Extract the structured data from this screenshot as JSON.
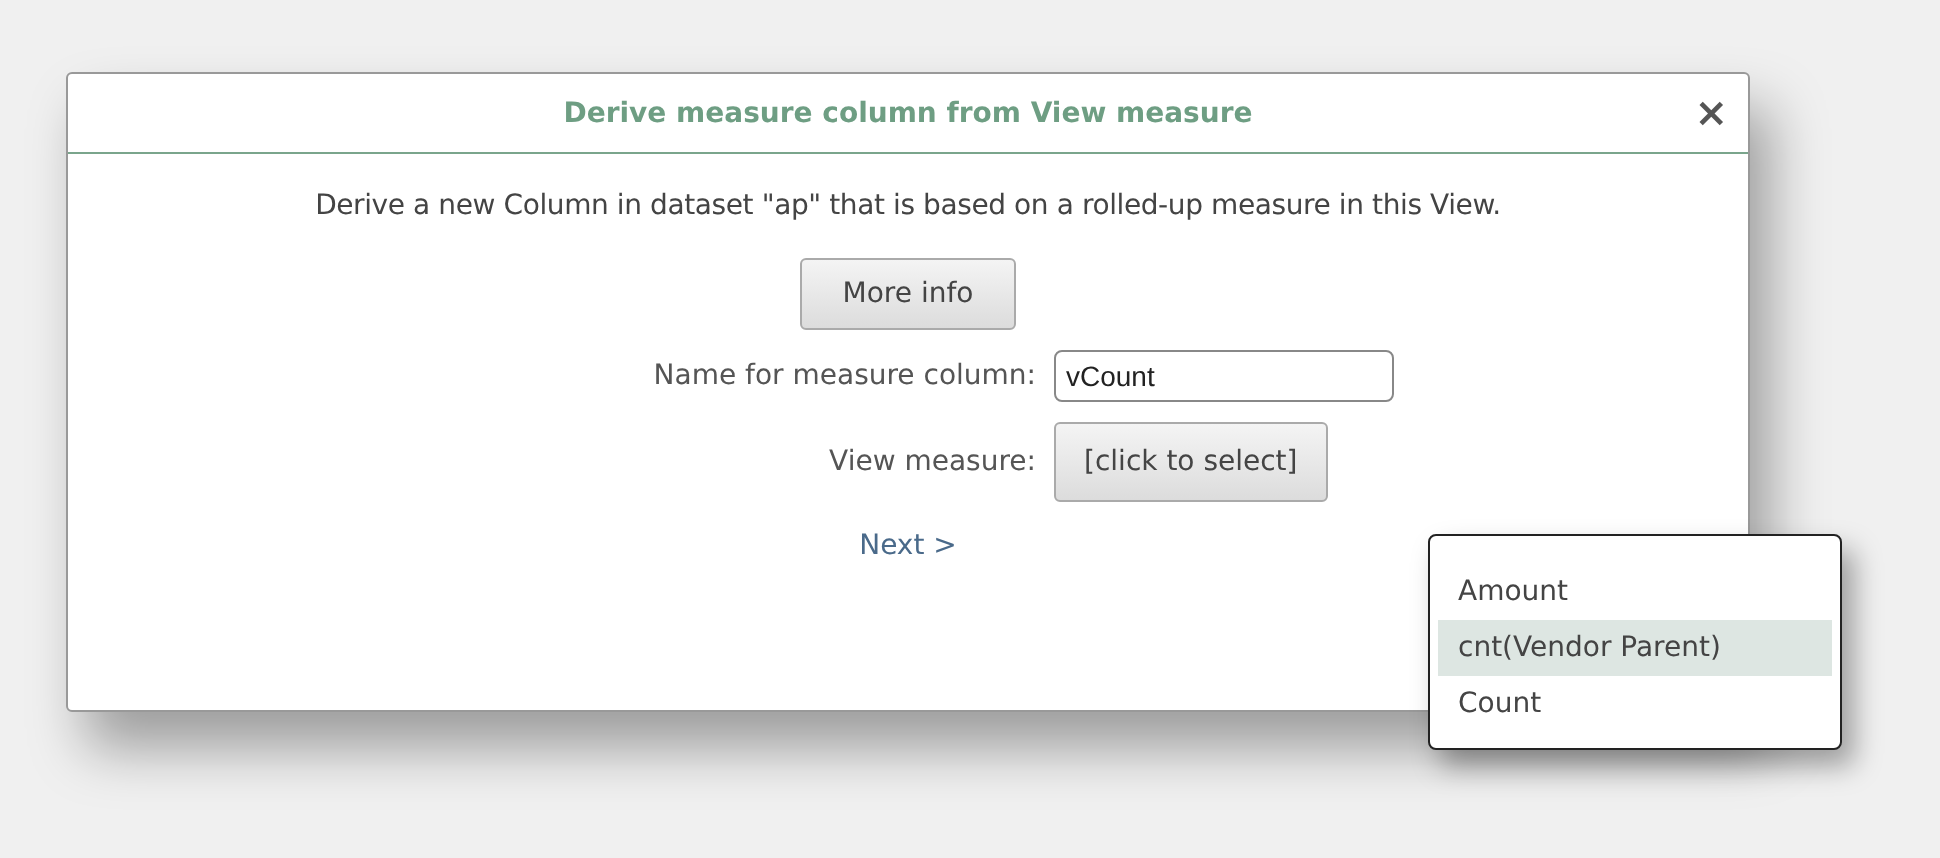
{
  "dialog": {
    "title": "Derive measure column from View measure",
    "close": "×",
    "description": "Derive a new Column in dataset \"ap\" that is based on a rolled-up measure in this View.",
    "more_info": "More info",
    "name_label": "Name for measure column:",
    "name_value": "vCount",
    "measure_label": "View measure:",
    "measure_button": "[click to select]",
    "next": "Next >"
  },
  "menu": {
    "items": [
      {
        "label": "Amount",
        "selected": false
      },
      {
        "label": "cnt(Vendor Parent)",
        "selected": true
      },
      {
        "label": "Count",
        "selected": false
      }
    ]
  }
}
